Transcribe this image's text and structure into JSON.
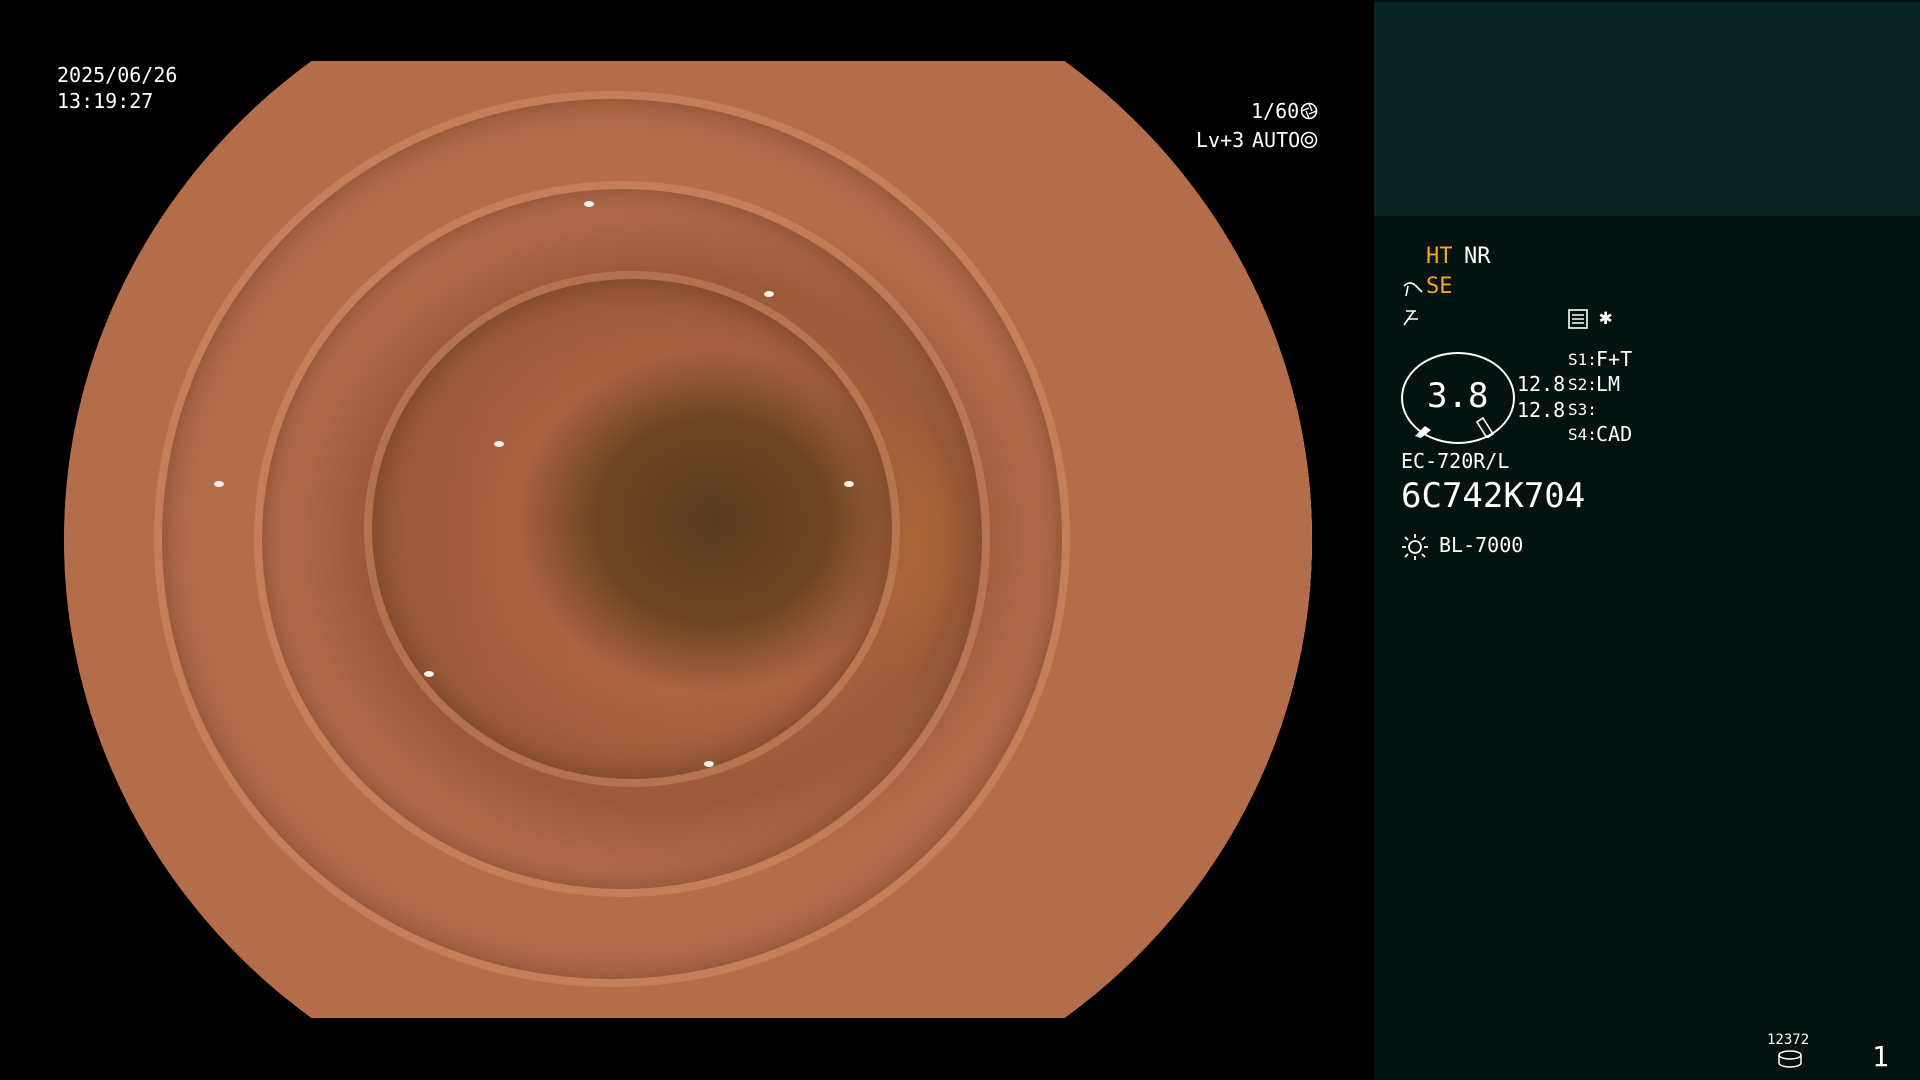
{
  "osd": {
    "date": "2025/06/26",
    "time": "13:19:27",
    "shutter": "1/60",
    "level": "Lv+3",
    "mode": "AUTO"
  },
  "panel": {
    "ht": "HT",
    "nr": "NR",
    "se": "SE",
    "star": "✱",
    "gauge_value": "3.8",
    "val1": "12.8",
    "val2": "12.8",
    "s1_key": "S1:",
    "s1_val": "F+T",
    "s2_key": "S2:",
    "s2_val": "LM",
    "s3_key": "S3:",
    "s3_val": "",
    "s4_key": "S4:",
    "s4_val": "CAD",
    "scope_model": "EC-720R/L",
    "serial": "6C742K704",
    "light_source": "BL-7000",
    "counter": "12372",
    "page": "1"
  },
  "colors": {
    "accent": "#f6a623",
    "panel_bg": "#041210",
    "panel_top": "#0b2424"
  }
}
